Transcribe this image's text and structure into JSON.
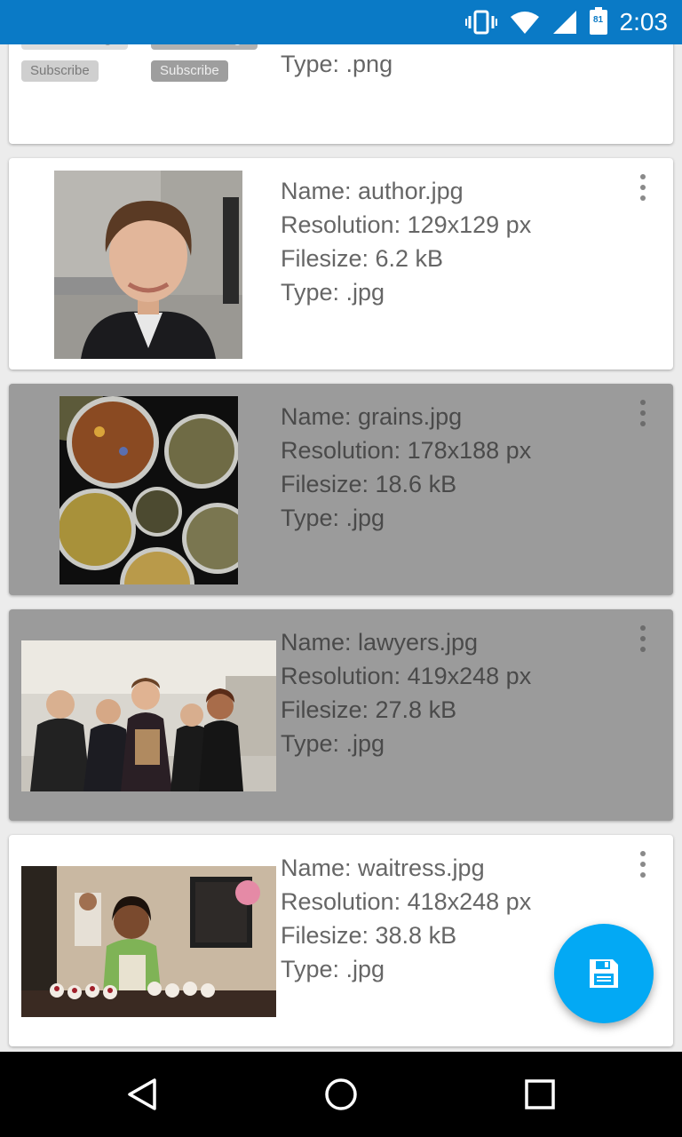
{
  "status_bar": {
    "time": "2:03",
    "battery_level": "81",
    "icons": [
      "vibrate-icon",
      "wifi-icon",
      "signal-icon",
      "battery-icon"
    ]
  },
  "cards": [
    {
      "partial": true,
      "buttons": [
        "Send message",
        "Send message",
        "Subscribe",
        "Subscribe"
      ],
      "type": "Type: .png"
    },
    {
      "name": "Name: author.jpg",
      "resolution": "Resolution: 129x129 px",
      "filesize": "Filesize: 6.2 kB",
      "type": "Type: .jpg",
      "selected": false
    },
    {
      "name": "Name: grains.jpg",
      "resolution": "Resolution: 178x188 px",
      "filesize": "Filesize: 18.6 kB",
      "type": "Type: .jpg",
      "selected": true
    },
    {
      "name": "Name: lawyers.jpg",
      "resolution": "Resolution: 419x248 px",
      "filesize": "Filesize: 27.8 kB",
      "type": "Type: .jpg",
      "selected": true
    },
    {
      "name": "Name: waitress.jpg",
      "resolution": "Resolution: 418x248 px",
      "filesize": "Filesize: 38.8 kB",
      "type": "Type: .jpg",
      "selected": false
    }
  ],
  "fab": {
    "icon": "save-icon"
  },
  "nav": {
    "icons": [
      "back-icon",
      "home-icon",
      "recents-icon"
    ]
  },
  "colors": {
    "status_bar": "#0a7ac6",
    "fab": "#03a9f4",
    "selected_card": "#9b9b9b",
    "card": "#ffffff"
  }
}
